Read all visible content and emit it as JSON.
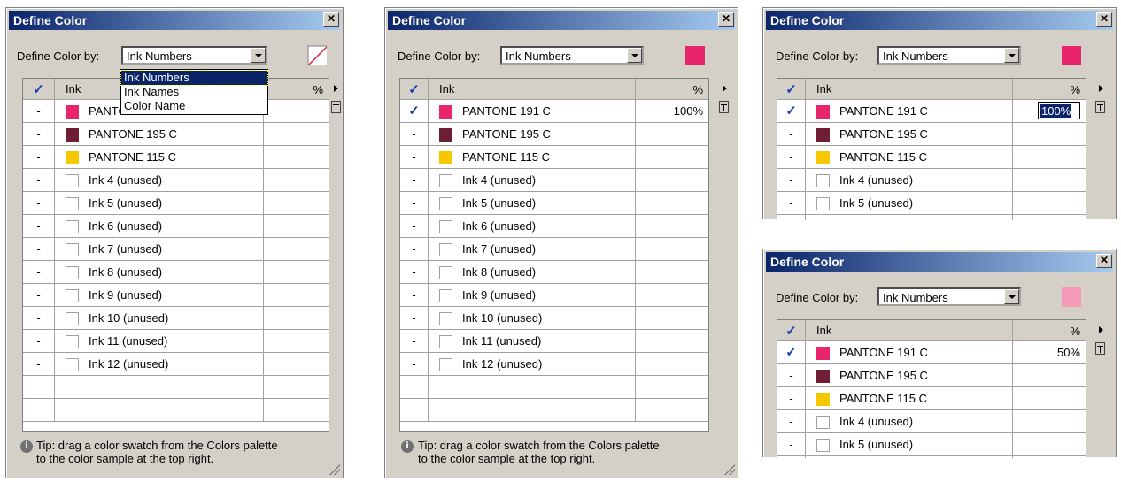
{
  "title": "Define Color",
  "define_label": "Define Color by:",
  "combo_value": "Ink Numbers",
  "close_glyph": "✕",
  "col_check": "✓",
  "col_ink": "Ink",
  "col_pct": "%",
  "dash": "-",
  "check": "✓",
  "tip_line1": "Tip: drag a color swatch  from the Colors palette",
  "tip_line2": "to the color sample at the top right.",
  "info_glyph": "i",
  "dropdown_options": [
    "Ink Numbers",
    "Ink Names",
    "Color Name"
  ],
  "colors": {
    "pink": "#e8256b",
    "maroon": "#6e1f36",
    "yellow": "#f7c800",
    "light_pink": "#f59ab8"
  },
  "inks": [
    {
      "name": "PANTONE 191 C",
      "swatch": "pink"
    },
    {
      "name": "PANTONE 195 C",
      "swatch": "maroon"
    },
    {
      "name": "PANTONE 115 C",
      "swatch": "yellow"
    },
    {
      "name": "Ink 4 (unused)",
      "swatch": ""
    },
    {
      "name": "Ink 5 (unused)",
      "swatch": ""
    },
    {
      "name": "Ink 6 (unused)",
      "swatch": ""
    },
    {
      "name": "Ink 7 (unused)",
      "swatch": ""
    },
    {
      "name": "Ink 8 (unused)",
      "swatch": ""
    },
    {
      "name": "Ink 9 (unused)",
      "swatch": ""
    },
    {
      "name": "Ink 10 (unused)",
      "swatch": ""
    },
    {
      "name": "Ink 11 (unused)",
      "swatch": ""
    },
    {
      "name": "Ink 12 (unused)",
      "swatch": ""
    }
  ],
  "panel1_ink1_visible": "PANTO",
  "panel2_pct": "100%",
  "panel3_edit": "100%",
  "panel4_pct": "50%"
}
